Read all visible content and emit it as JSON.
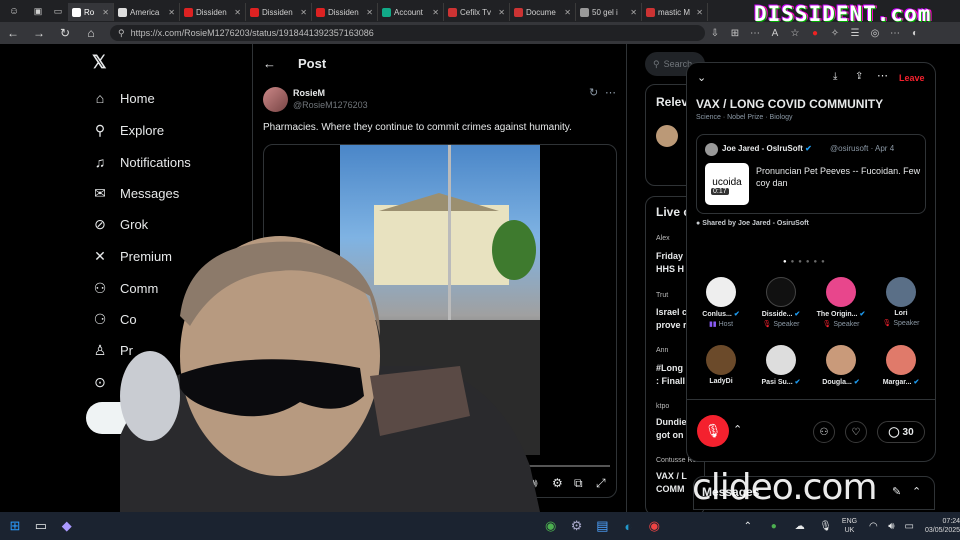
{
  "tabs": [
    {
      "label": "Ro",
      "active": true
    },
    {
      "label": "America"
    },
    {
      "label": "Dissiden"
    },
    {
      "label": "Dissiden"
    },
    {
      "label": "Dissiden"
    },
    {
      "label": "Account"
    },
    {
      "label": "Cefilx Tv"
    },
    {
      "label": "Docume"
    },
    {
      "label": "50 gel i"
    },
    {
      "label": "mastic M"
    }
  ],
  "browser": {
    "url": "https://x.com/RosieM1276203/status/1918441392357163086",
    "brand": "DISSIDENT.com"
  },
  "sidebar": {
    "items": [
      {
        "label": "Home",
        "icon": "home-icon"
      },
      {
        "label": "Explore",
        "icon": "search-icon"
      },
      {
        "label": "Notifications",
        "icon": "bell-icon"
      },
      {
        "label": "Messages",
        "icon": "mail-icon"
      },
      {
        "label": "Grok",
        "icon": "grok-icon"
      },
      {
        "label": "Premium",
        "icon": "x-icon"
      },
      {
        "label": "Comm",
        "icon": "people-icon"
      },
      {
        "label": "Co",
        "icon": "briefcase-icon"
      },
      {
        "label": "Pr",
        "icon": "person-icon"
      }
    ]
  },
  "post": {
    "header": "Post",
    "author_name": "RosieM",
    "author_handle": "@RosieM1276203",
    "text": "Pharmacies. Where they continue to commit crimes against humanity.",
    "video_time": "10"
  },
  "right": {
    "search_placeholder": "Search",
    "relevant": "Relev",
    "live": "Live o",
    "live_items": [
      {
        "name": "Alex",
        "text1": "Friday",
        "text2": "HHS H"
      },
      {
        "name": "Trut",
        "text1": "Israel c",
        "text2": "prove r"
      },
      {
        "name": "Ann",
        "text1": "#Long",
        "text2": ": Finall"
      },
      {
        "name": "ktpo",
        "text1": "Dundie",
        "text2": "got on"
      },
      {
        "name": "Contusse Research",
        "text1": "VAX / L",
        "text2": "COMM"
      }
    ],
    "messages": "Messages"
  },
  "space": {
    "leave": "Leave",
    "title": "VAX / LONG COVID COMMUNITY",
    "tags": "Science · Nobel Prize · Biology",
    "pinned": {
      "name": "Joe Jared - OsIruSoft",
      "handle": "@osirusoft · Apr 4",
      "thumb_text": "ucoida",
      "duration": "0:17",
      "text": "Pronuncian Pet Peeves -- Fucoidan. Few coy dan"
    },
    "shared_by": "Shared by Joe Jared - OsiruSoft",
    "speakers": [
      {
        "name": "Conlus...",
        "role": "Host"
      },
      {
        "name": "Disside...",
        "role": "Speaker"
      },
      {
        "name": "The Origin...",
        "role": "Speaker"
      },
      {
        "name": "Lori",
        "role": "Speaker"
      },
      {
        "name": "LadyDi",
        "role": ""
      },
      {
        "name": "Pasi Su...",
        "role": ""
      },
      {
        "name": "Dougla...",
        "role": ""
      },
      {
        "name": "Margar...",
        "role": ""
      }
    ],
    "reply_count": "30"
  },
  "taskbar": {
    "lang1": "ENG",
    "lang2": "UK",
    "time": "07:24",
    "date": "03/05/2025"
  },
  "watermark": "clideo.com"
}
